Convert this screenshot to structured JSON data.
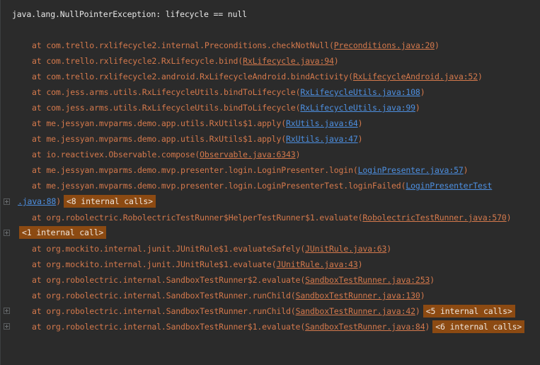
{
  "console": {
    "exception": "java.lang.NullPointerException: lifecycle == null",
    "frames": [
      {
        "at": "at ",
        "method": "com.trello.rxlifecycle2.internal.Preconditions.checkNotNull",
        "link": "Preconditions.java:20",
        "badge": ""
      },
      {
        "at": "at ",
        "method": "com.trello.rxlifecycle2.RxLifecycle.bind",
        "link": "RxLifecycle.java:94",
        "badge": ""
      },
      {
        "at": "at ",
        "method": "com.trello.rxlifecycle2.android.RxLifecycleAndroid.bindActivity",
        "link": "RxLifecycleAndroid.java:52",
        "badge": ""
      },
      {
        "at": "at ",
        "method": "com.jess.arms.utils.RxLifecycleUtils.bindToLifecycle",
        "link": "RxLifecycleUtils.java:108",
        "badge": ""
      },
      {
        "at": "at ",
        "method": "com.jess.arms.utils.RxLifecycleUtils.bindToLifecycle",
        "link": "RxLifecycleUtils.java:99",
        "badge": ""
      },
      {
        "at": "at ",
        "method": "me.jessyan.mvparms.demo.app.utils.RxUtils$1.apply",
        "link": "RxUtils.java:64",
        "badge": ""
      },
      {
        "at": "at ",
        "method": "me.jessyan.mvparms.demo.app.utils.RxUtils$1.apply",
        "link": "RxUtils.java:47",
        "badge": ""
      },
      {
        "at": "at ",
        "method": "io.reactivex.Observable.compose",
        "link": "Observable.java:6343",
        "badge": ""
      },
      {
        "at": "at ",
        "method": "me.jessyan.mvparms.demo.mvp.presenter.login.LoginPresenter.login",
        "link": "LoginPresenter.java:57",
        "badge": ""
      },
      {
        "at": "at ",
        "method": "me.jessyan.mvparms.demo.mvp.presenter.login.LoginPresenterTest.loginFailed",
        "link": "LoginPresenterTest",
        "badge": ""
      }
    ],
    "wrap_link": ".java:88",
    "wrap_badge": "<8 internal calls>",
    "frame_robo": {
      "at": "at ",
      "method": "org.robolectric.RobolectricTestRunner$HelperTestRunner$1.evaluate",
      "link": "RobolectricTestRunner.java:570"
    },
    "one_call_badge": "<1 internal call>",
    "frames2": [
      {
        "at": "at ",
        "method": "org.mockito.internal.junit.JUnitRule$1.evaluateSafely",
        "link": "JUnitRule.java:63",
        "badge": ""
      },
      {
        "at": "at ",
        "method": "org.mockito.internal.junit.JUnitRule$1.evaluate",
        "link": "JUnitRule.java:43",
        "badge": ""
      },
      {
        "at": "at ",
        "method": "org.robolectric.internal.SandboxTestRunner$2.evaluate",
        "link": "SandboxTestRunner.java:253",
        "badge": ""
      },
      {
        "at": "at ",
        "method": "org.robolectric.internal.SandboxTestRunner.runChild",
        "link": "SandboxTestRunner.java:130",
        "badge": ""
      },
      {
        "at": "at ",
        "method": "org.robolectric.internal.SandboxTestRunner.runChild",
        "link": "SandboxTestRunner.java:42",
        "badge": "<5 internal calls>"
      },
      {
        "at": "at ",
        "method": "org.robolectric.internal.SandboxTestRunner$1.evaluate",
        "link": "SandboxTestRunner.java:84",
        "badge": "<6 internal calls>"
      }
    ]
  },
  "colors": {
    "background": "#2b2b2b",
    "exception_text": "#e7e7e7",
    "frame_text": "#d4794c",
    "user_link": "#4d8fe0",
    "badge_bg": "#8c4a12"
  },
  "icons": {
    "fold": "plus-square-icon"
  }
}
